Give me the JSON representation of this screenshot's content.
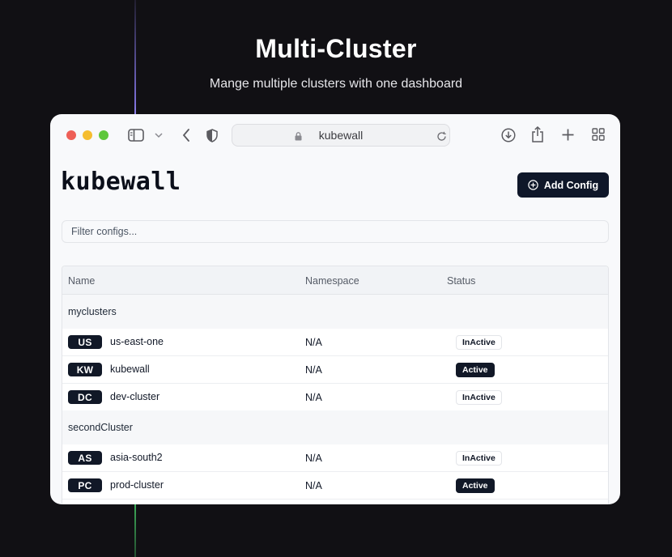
{
  "hero": {
    "title": "Multi-Cluster",
    "subtitle": "Mange multiple clusters with one dashboard"
  },
  "browser": {
    "url_text": "kubewall",
    "icons": [
      "sidebar-icon",
      "chevron-down-icon",
      "back-icon",
      "shield-icon",
      "lock-icon",
      "reload-icon",
      "download-icon",
      "share-icon",
      "plus-icon",
      "tabs-grid-icon"
    ]
  },
  "app": {
    "brand": "kubewall",
    "add_config_label": "Add Config",
    "filter_placeholder": "Filter configs...",
    "columns": {
      "name": "Name",
      "namespace": "Namespace",
      "status": "Status"
    },
    "groups": [
      {
        "name": "myclusters",
        "rows": [
          {
            "badge": "US",
            "name": "us-east-one",
            "namespace": "N/A",
            "status": "InActive"
          },
          {
            "badge": "KW",
            "name": "kubewall",
            "namespace": "N/A",
            "status": "Active"
          },
          {
            "badge": "DC",
            "name": "dev-cluster",
            "namespace": "N/A",
            "status": "InActive"
          }
        ]
      },
      {
        "name": "secondCluster",
        "rows": [
          {
            "badge": "AS",
            "name": "asia-south2",
            "namespace": "N/A",
            "status": "InActive"
          },
          {
            "badge": "PC",
            "name": "prod-cluster",
            "namespace": "N/A",
            "status": "Active"
          }
        ]
      }
    ]
  },
  "colors": {
    "background": "#111014",
    "primary": "#0f1729",
    "accent_top": "#7c6fd8",
    "accent_bottom": "#3fae5a"
  }
}
